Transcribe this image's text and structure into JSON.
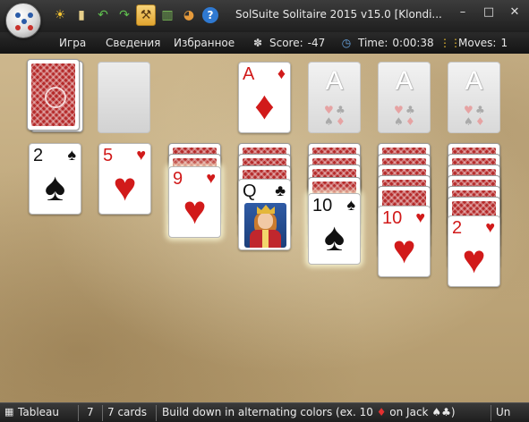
{
  "window": {
    "title": "SolSuite Solitaire 2015 v15.0  [Klondi...",
    "minimize_icon": "minimize-icon",
    "maximize_icon": "maximize-icon",
    "close_icon": "close-icon"
  },
  "toolbar": {
    "buttons": [
      {
        "name": "new-game-sun-icon",
        "glyph": "☀"
      },
      {
        "name": "deal-cards-icon",
        "glyph": "▮"
      },
      {
        "name": "undo-icon",
        "glyph": "↶"
      },
      {
        "name": "redo-icon",
        "glyph": "↷"
      },
      {
        "name": "hint-hammer-icon",
        "glyph": "⚒"
      },
      {
        "name": "statistics-icon",
        "glyph": "▥"
      },
      {
        "name": "palette-icon",
        "glyph": "◕"
      },
      {
        "name": "help-icon",
        "glyph": "?"
      }
    ]
  },
  "menu": {
    "items": [
      "Игра",
      "Сведения",
      "Избранное"
    ]
  },
  "stats": {
    "score_label": "Score:",
    "score_value": "-47",
    "time_label": "Time:",
    "time_value": "0:00:38",
    "moves_label": "Moves:",
    "moves_value": "1"
  },
  "cards": {
    "waste_1": {
      "rank": "A",
      "suit": "♦",
      "color": "red"
    },
    "tableau_1": {
      "rank": "2",
      "suit": "♠",
      "color": "black"
    },
    "tableau_2": {
      "rank": "5",
      "suit": "♥",
      "color": "red"
    },
    "tableau_3": {
      "rank": "9",
      "suit": "♥",
      "color": "red"
    },
    "tableau_4": {
      "rank": "Q",
      "suit": "♣",
      "color": "black"
    },
    "tableau_5": {
      "rank": "10",
      "suit": "♠",
      "color": "black"
    },
    "tableau_6": {
      "rank": "10",
      "suit": "♥",
      "color": "red"
    },
    "tableau_7": {
      "rank": "2",
      "suit": "♥",
      "color": "red"
    },
    "foundation_letter": "A"
  },
  "statusbar": {
    "area": "Tableau",
    "column": "7",
    "count": "7 cards",
    "hint_prefix": "Build down in alternating colors (ex. 10 ",
    "hint_suit1": "♦",
    "hint_middle": " on Jack ",
    "hint_suit2": "♠",
    "hint_suit3": "♣",
    "hint_suffix": ")",
    "right_cut": "Un"
  }
}
